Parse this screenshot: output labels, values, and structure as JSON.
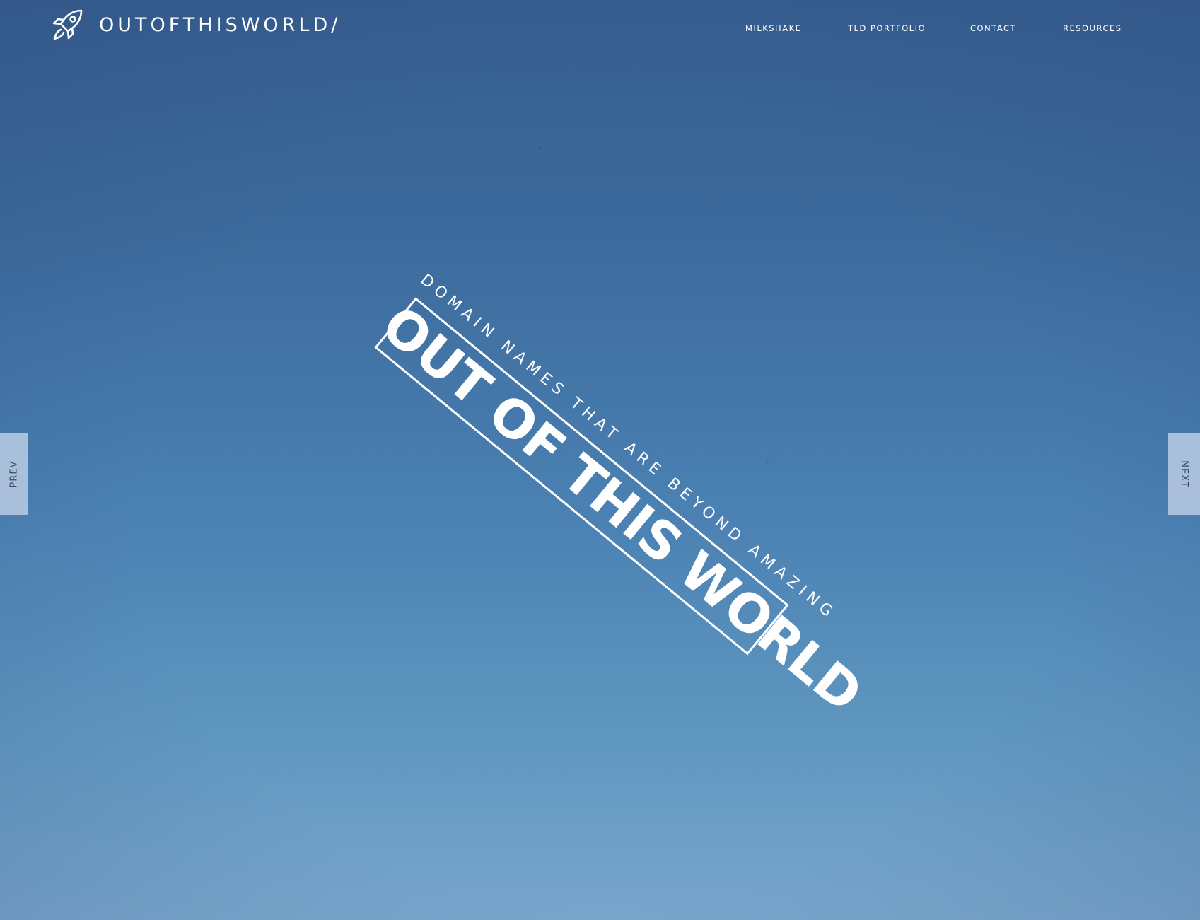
{
  "brand": {
    "name": "OUTOFTHISWORLD/",
    "logo_icon": "rocket-icon"
  },
  "nav": {
    "items": [
      {
        "label": "MILKSHAKE"
      },
      {
        "label": "TLD PORTFOLIO"
      },
      {
        "label": "CONTACT"
      },
      {
        "label": "RESOURCES"
      }
    ]
  },
  "hero": {
    "tagline": "DOMAIN NAMES THAT ARE BEYOND AMAZING",
    "title": "OUT OF THIS WORLD"
  },
  "slider": {
    "prev_label": "PREV",
    "next_label": "NEXT"
  },
  "colors": {
    "sky_top": "#365e90",
    "sky_bottom": "#79a6cc",
    "text": "#ffffff",
    "tab_bg": "#c0d0e4",
    "tab_text": "#3a4a66"
  }
}
